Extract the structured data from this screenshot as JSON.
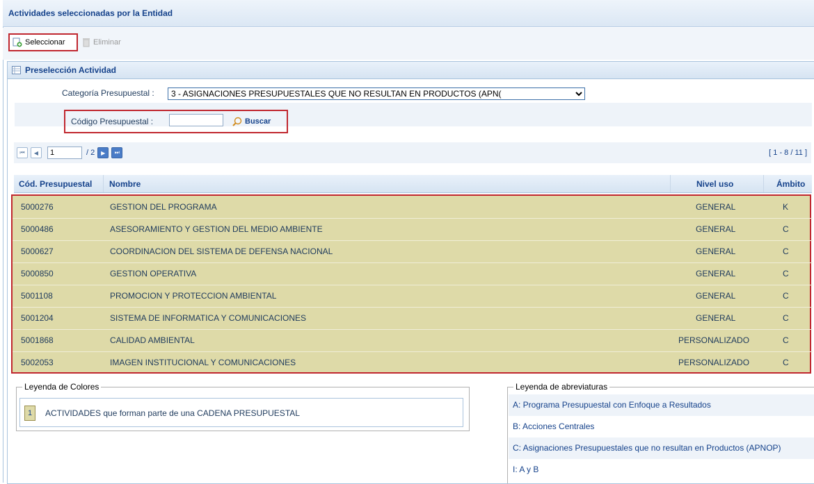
{
  "window": {
    "title": "Actividades seleccionadas por la Entidad"
  },
  "toolbar": {
    "select_label": "Seleccionar",
    "delete_label": "Eliminar"
  },
  "panel": {
    "title": "Preselección Actividad"
  },
  "form": {
    "category_label": "Categoría Presupuestal :",
    "category_value": "3 - ASIGNACIONES PRESUPUESTALES QUE NO RESULTAN EN PRODUCTOS (APN(",
    "code_label": "Código Presupuestal :",
    "code_value": "",
    "search_label": "Buscar"
  },
  "pager": {
    "current_page": "1",
    "total_pages": "/ 2",
    "range": "[ 1 - 8 / 11 ]"
  },
  "grid": {
    "headers": {
      "code": "Cód. Presupuestal",
      "name": "Nombre",
      "level": "Nivel uso",
      "scope": "Ámbito"
    },
    "rows": [
      {
        "code": "5000276",
        "name": "GESTION DEL PROGRAMA",
        "level": "GENERAL",
        "scope": "K"
      },
      {
        "code": "5000486",
        "name": "ASESORAMIENTO Y GESTION DEL MEDIO AMBIENTE",
        "level": "GENERAL",
        "scope": "C"
      },
      {
        "code": "5000627",
        "name": "COORDINACION DEL SISTEMA DE DEFENSA NACIONAL",
        "level": "GENERAL",
        "scope": "C"
      },
      {
        "code": "5000850",
        "name": "GESTION OPERATIVA",
        "level": "GENERAL",
        "scope": "C"
      },
      {
        "code": "5001108",
        "name": "PROMOCION Y PROTECCION AMBIENTAL",
        "level": "GENERAL",
        "scope": "C"
      },
      {
        "code": "5001204",
        "name": "SISTEMA DE INFORMATICA Y COMUNICACIONES",
        "level": "GENERAL",
        "scope": "C"
      },
      {
        "code": "5001868",
        "name": "CALIDAD AMBIENTAL",
        "level": "PERSONALIZADO",
        "scope": "C"
      },
      {
        "code": "5002053",
        "name": "IMAGEN INSTITUCIONAL Y COMUNICACIONES",
        "level": "PERSONALIZADO",
        "scope": "C"
      }
    ]
  },
  "legend_colors": {
    "title": "Leyenda de Colores",
    "swatch_number": "1",
    "text": "ACTIVIDADES que forman parte de una CADENA PRESUPUESTAL",
    "swatch_color": "#dedaa8"
  },
  "legend_abbr": {
    "title": "Leyenda de abreviaturas",
    "items": [
      "A: Programa Presupuestal con Enfoque a Resultados",
      "B: Acciones Centrales",
      "C: Asignaciones Presupuestales que no resultan en Productos (APNOP)",
      "I: A y B"
    ]
  },
  "colors": {
    "accent": "#15428b",
    "highlight_border": "#c0262e"
  }
}
